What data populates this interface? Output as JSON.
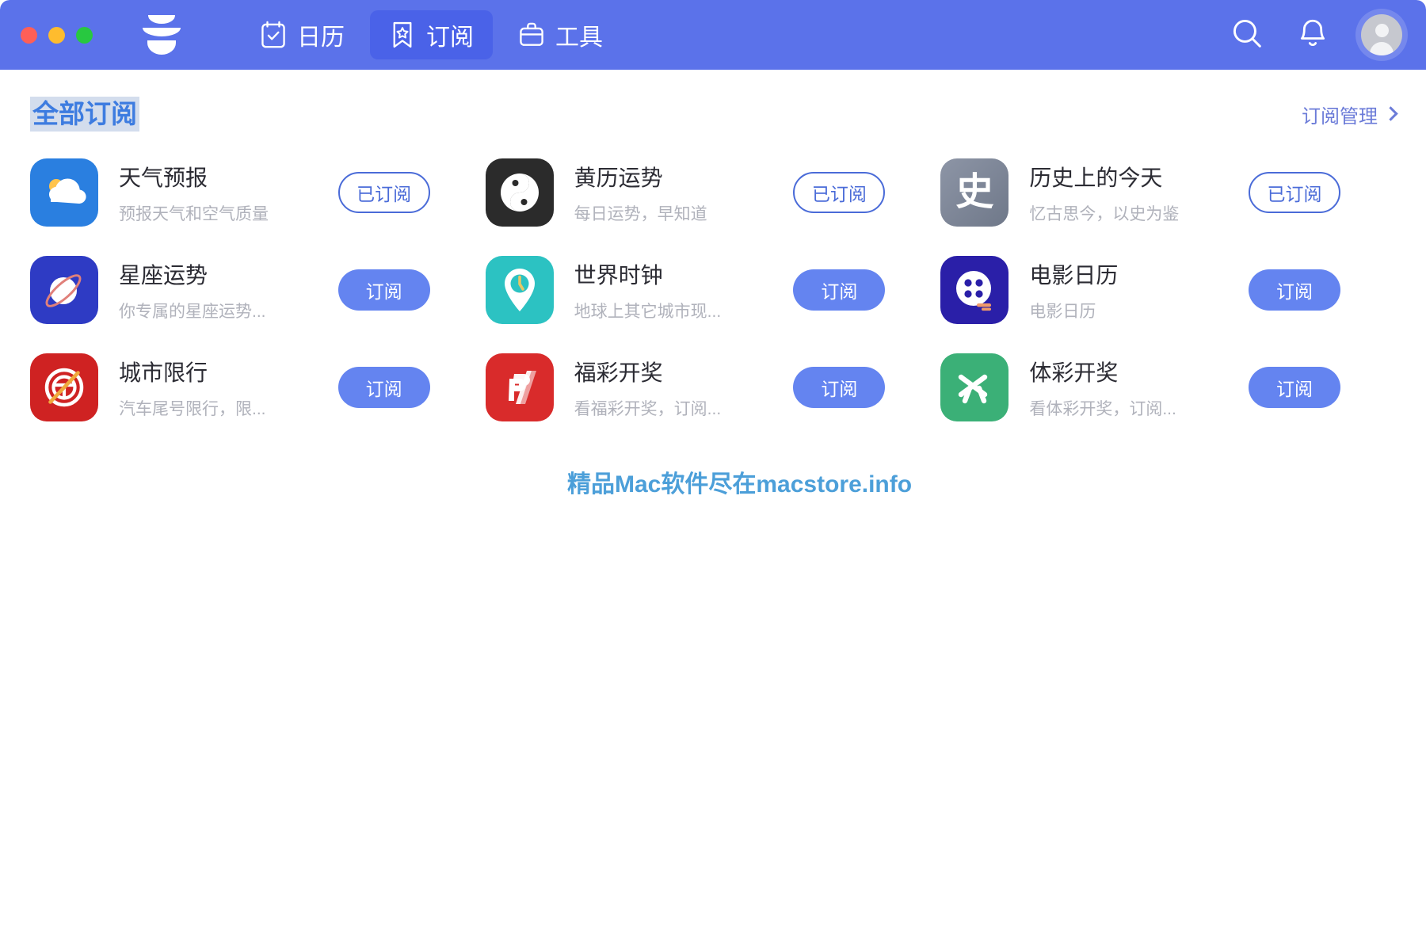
{
  "window": {
    "traffic_lights": [
      "close",
      "minimize",
      "maximize"
    ],
    "logo": "stacked-bowls-logo"
  },
  "header": {
    "tabs": [
      {
        "label": "日历",
        "icon": "calendar-check-icon",
        "active": false
      },
      {
        "label": "订阅",
        "icon": "bookmark-star-icon",
        "active": true
      },
      {
        "label": "工具",
        "icon": "toolbox-icon",
        "active": false
      }
    ],
    "actions": [
      {
        "name": "search-icon",
        "label": "搜索"
      },
      {
        "name": "bell-icon",
        "label": "通知"
      },
      {
        "name": "avatar",
        "label": "账户"
      }
    ]
  },
  "page": {
    "title": "全部订阅",
    "manage_link": "订阅管理"
  },
  "labels": {
    "subscribed": "已订阅",
    "subscribe": "订阅"
  },
  "colors": {
    "brand": "#5b72ea",
    "accent_button": "#6484f0",
    "outline_button": "#4a6bd8",
    "title_text": "#3d7ce0",
    "title_highlight": "#d3dded"
  },
  "subscriptions": [
    {
      "name": "天气预报",
      "desc": "预报天气和空气质量",
      "icon": "weather-cloud-sun-icon",
      "icon_bg": "#2a7fe0",
      "button": "已订阅",
      "subscribed": true
    },
    {
      "name": "黄历运势",
      "desc": "每日运势，早知道",
      "icon": "yin-yang-icon",
      "icon_bg": "#2b2b2b",
      "button": "已订阅",
      "subscribed": true
    },
    {
      "name": "历史上的今天",
      "desc": "忆古思今，以史为鉴",
      "icon": "history-shi-icon",
      "icon_bg": "#7b8496",
      "button": "已订阅",
      "subscribed": true
    },
    {
      "name": "星座运势",
      "desc": "你专属的星座运势...",
      "icon": "planet-ring-icon",
      "icon_bg": "#2e3bc4",
      "button": "订阅",
      "subscribed": false
    },
    {
      "name": "世界时钟",
      "desc": "地球上其它城市现...",
      "icon": "map-pin-clock-icon",
      "icon_bg": "#2cc2c2",
      "button": "订阅",
      "subscribed": false
    },
    {
      "name": "电影日历",
      "desc": "电影日历",
      "icon": "film-reel-icon",
      "icon_bg": "#2a1fa8",
      "button": "订阅",
      "subscribed": false
    },
    {
      "name": "城市限行",
      "desc": "汽车尾号限行，限...",
      "icon": "no-driving-icon",
      "icon_bg": "#cf2222",
      "button": "订阅",
      "subscribed": false
    },
    {
      "name": "福彩开奖",
      "desc": "看福彩开奖，订阅...",
      "icon": "welfare-lottery-icon",
      "icon_bg": "#d92b2b",
      "button": "订阅",
      "subscribed": false
    },
    {
      "name": "体彩开奖",
      "desc": "看体彩开奖，订阅...",
      "icon": "sports-lottery-icon",
      "icon_bg": "#3bb077",
      "button": "订阅",
      "subscribed": false
    }
  ],
  "watermark": "精品Mac软件尽在macstore.info"
}
